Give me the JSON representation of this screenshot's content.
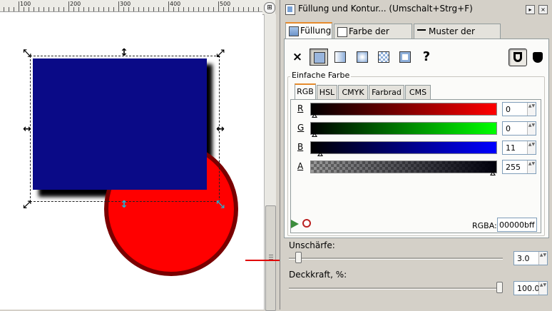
{
  "ruler": {
    "labels": [
      "100",
      "200",
      "300",
      "400",
      "500"
    ]
  },
  "canvas": {
    "rect_color": "#0a0a87",
    "circle_fill": "#ff0000",
    "circle_stroke": "#7a0000",
    "zoom_icon": "zoom-fit-icon"
  },
  "panel": {
    "title": "Füllung und Kontur... (Umschalt+Strg+F)",
    "tabs": {
      "fill": "Füllung",
      "stroke_paint": "Farbe der Kontur",
      "stroke_style": "Muster der Kontur"
    },
    "fill_types": {
      "none": "×",
      "unset": "?",
      "icons": [
        "no-paint-icon",
        "flat-color-icon",
        "linear-gradient-icon",
        "radial-gradient-icon",
        "pattern-icon",
        "swatch-icon",
        "unset-paint-icon",
        "fill-rule-evenodd-icon",
        "fill-rule-nonzero-icon"
      ]
    },
    "flat_color_label": "Einfache Farbe",
    "color_tabs": [
      "RGB",
      "HSL",
      "CMYK",
      "Farbrad",
      "CMS"
    ],
    "channels": [
      {
        "label": "R",
        "value": "0"
      },
      {
        "label": "G",
        "value": "0"
      },
      {
        "label": "B",
        "value": "11"
      },
      {
        "label": "A",
        "value": "255"
      }
    ],
    "rgba_label": "RGBA:",
    "rgba_value": "00000bff",
    "blur_label": "Unschärfe:",
    "blur_value": "3.0",
    "blur_fraction": 0.03,
    "opacity_label": "Deckkraft, %:",
    "opacity_value": "100.0",
    "opacity_fraction": 1.0,
    "spin_arrows": "▲▼"
  }
}
